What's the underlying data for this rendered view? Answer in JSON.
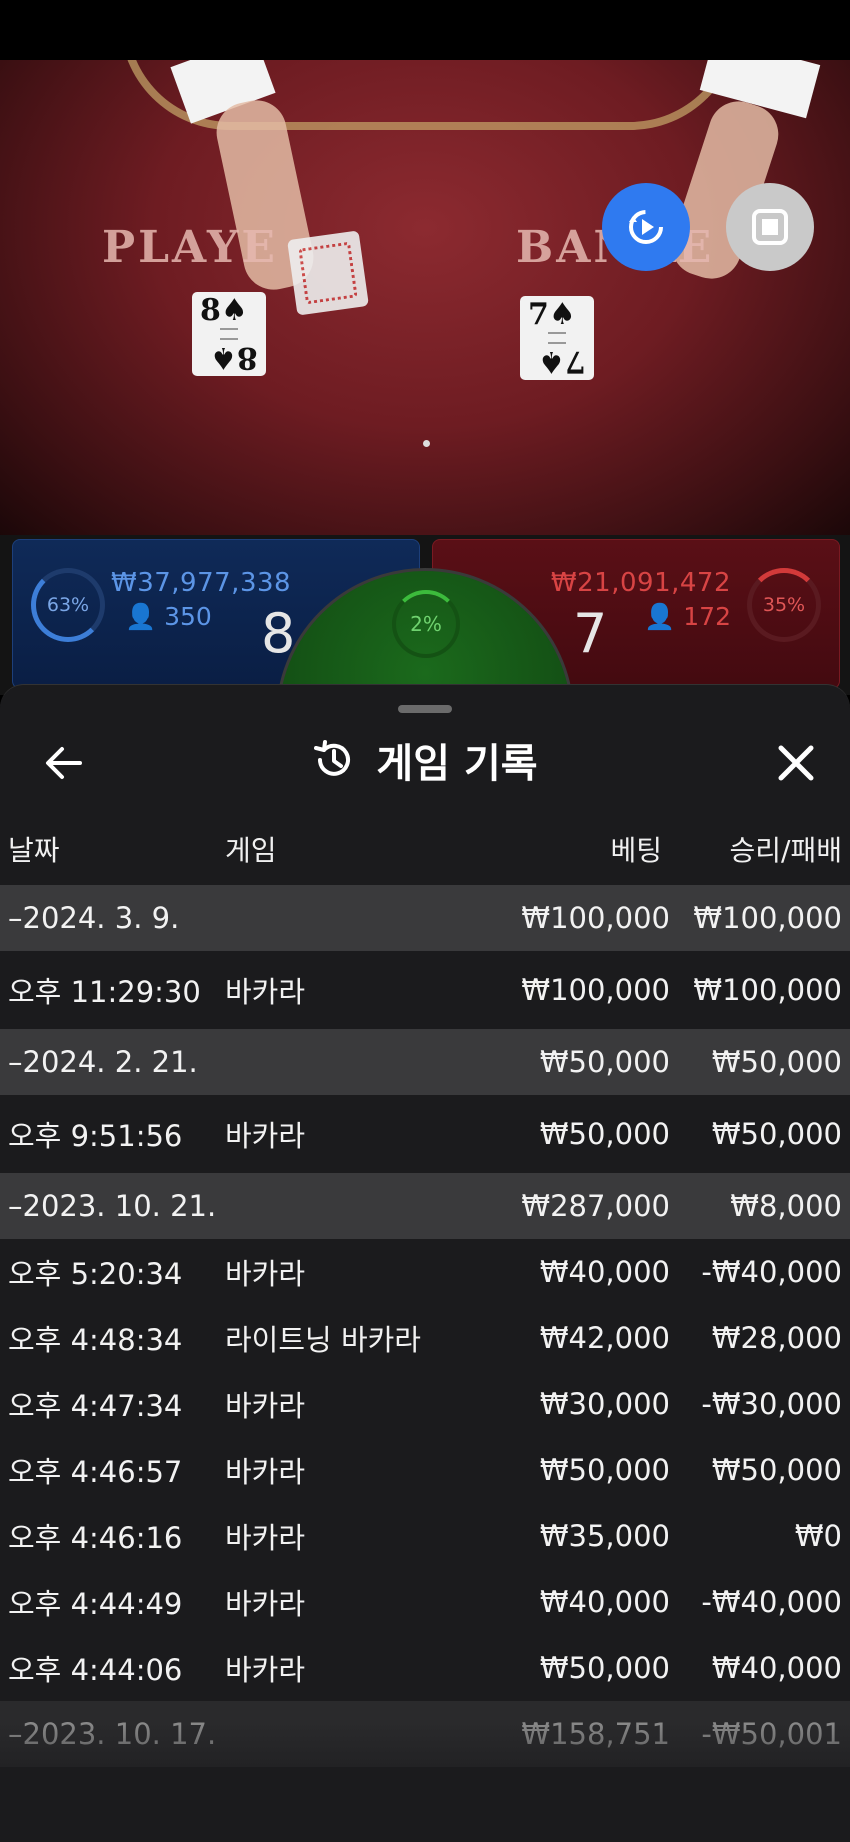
{
  "video": {
    "felt_player": "PLAYE",
    "felt_banker": "BANKE",
    "player_card": {
      "rank": "8",
      "suit": "♠"
    },
    "banker_card": {
      "rank": "7",
      "suit": "♠"
    }
  },
  "controls": {
    "replay_icon": "replay-icon",
    "stop_icon": "stop-icon"
  },
  "scoreboard": {
    "player": {
      "percent": "63%",
      "amount": "₩37,977,338",
      "count": "350",
      "score": "8"
    },
    "banker": {
      "percent": "35%",
      "amount": "₩21,091,472",
      "count": "172",
      "score": "7"
    },
    "tie": {
      "percent": "2%"
    }
  },
  "sheet": {
    "title": "게임 기록",
    "columns": {
      "date": "날짜",
      "game": "게임",
      "bet": "베팅",
      "win_loss": "승리/패배"
    },
    "rows": [
      {
        "type": "date",
        "date": "–2024. 3. 9.",
        "bet": "₩100,000",
        "win": "₩100,000"
      },
      {
        "type": "game",
        "time": "오후 11:29:30",
        "game": "바카라",
        "bet": "₩100,000",
        "win": "₩100,000"
      },
      {
        "type": "date",
        "date": "–2024. 2. 21.",
        "bet": "₩50,000",
        "win": "₩50,000"
      },
      {
        "type": "game",
        "time": "오후 9:51:56",
        "game": "바카라",
        "bet": "₩50,000",
        "win": "₩50,000"
      },
      {
        "type": "date",
        "date": "–2023. 10. 21.",
        "bet": "₩287,000",
        "win": "₩8,000"
      },
      {
        "type": "game",
        "time": "오후 5:20:34",
        "game": "바카라",
        "bet": "₩40,000",
        "win": "-₩40,000"
      },
      {
        "type": "game",
        "time": "오후 4:48:34",
        "game": "라이트닝 바카라",
        "bet": "₩42,000",
        "win": "₩28,000"
      },
      {
        "type": "game",
        "time": "오후 4:47:34",
        "game": "바카라",
        "bet": "₩30,000",
        "win": "-₩30,000"
      },
      {
        "type": "game",
        "time": "오후 4:46:57",
        "game": "바카라",
        "bet": "₩50,000",
        "win": "₩50,000"
      },
      {
        "type": "game",
        "time": "오후 4:46:16",
        "game": "바카라",
        "bet": "₩35,000",
        "win": "₩0"
      },
      {
        "type": "game",
        "time": "오후 4:44:49",
        "game": "바카라",
        "bet": "₩40,000",
        "win": "-₩40,000"
      },
      {
        "type": "game",
        "time": "오후 4:44:06",
        "game": "바카라",
        "bet": "₩50,000",
        "win": "₩40,000"
      },
      {
        "type": "date",
        "date": "–2023. 10. 17.",
        "bet": "₩158,751",
        "win": "-₩50,001"
      }
    ]
  }
}
